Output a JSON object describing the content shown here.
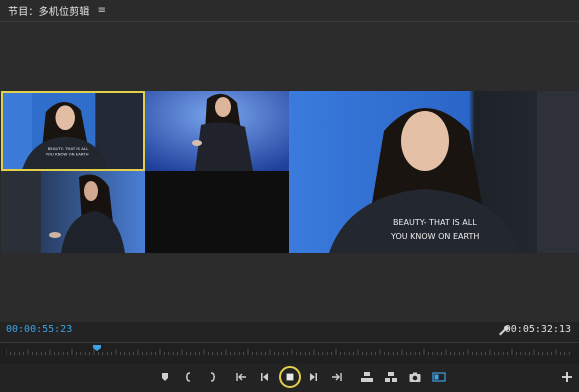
{
  "panel": {
    "title": "节目：多机位剪辑"
  },
  "timecode": {
    "current": "00:00:55:23",
    "duration": "00:05:32:13"
  },
  "shirt_text": {
    "line1": "BEAUTY- THAT IS ALL",
    "line2": "YOU KNOW ON EARTH"
  },
  "playhead_fraction": 0.16,
  "colors": {
    "accent_blue": "#3aa3e6",
    "selection_yellow": "#e3d04a",
    "backdrop_blue": "#2a5fb8"
  },
  "transport_icons": [
    "add-marker-icon",
    "mark-in-icon",
    "mark-out-icon",
    "go-to-in-icon",
    "step-back-icon",
    "stop-icon",
    "step-forward-icon",
    "go-to-out-icon",
    "lift-icon",
    "extract-icon",
    "export-frame-icon",
    "multicam-toggle-icon",
    "add-button-icon"
  ]
}
